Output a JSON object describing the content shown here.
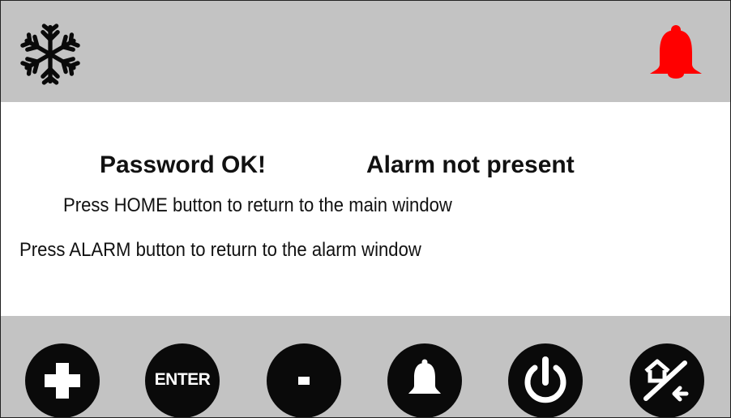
{
  "header": {
    "mode_icon": "snowflake-icon",
    "alarm_icon": "bell-icon",
    "alarm_icon_color": "#ff0000"
  },
  "status": {
    "password": "Password OK!",
    "alarm": "Alarm not present"
  },
  "messages": {
    "home": "Press HOME button to return to the main window",
    "alarm": "Press ALARM button to return to the alarm window"
  },
  "buttons": {
    "plus_icon": "plus-icon",
    "enter_label": "ENTER",
    "minus_icon": "minus-icon",
    "alarm_icon": "bell-icon",
    "power_icon": "power-icon",
    "home_icon": "home-back-icon"
  },
  "colors": {
    "bar_background": "#c3c3c3",
    "button_background": "#0a0a0a",
    "alarm_red": "#ff0000"
  }
}
